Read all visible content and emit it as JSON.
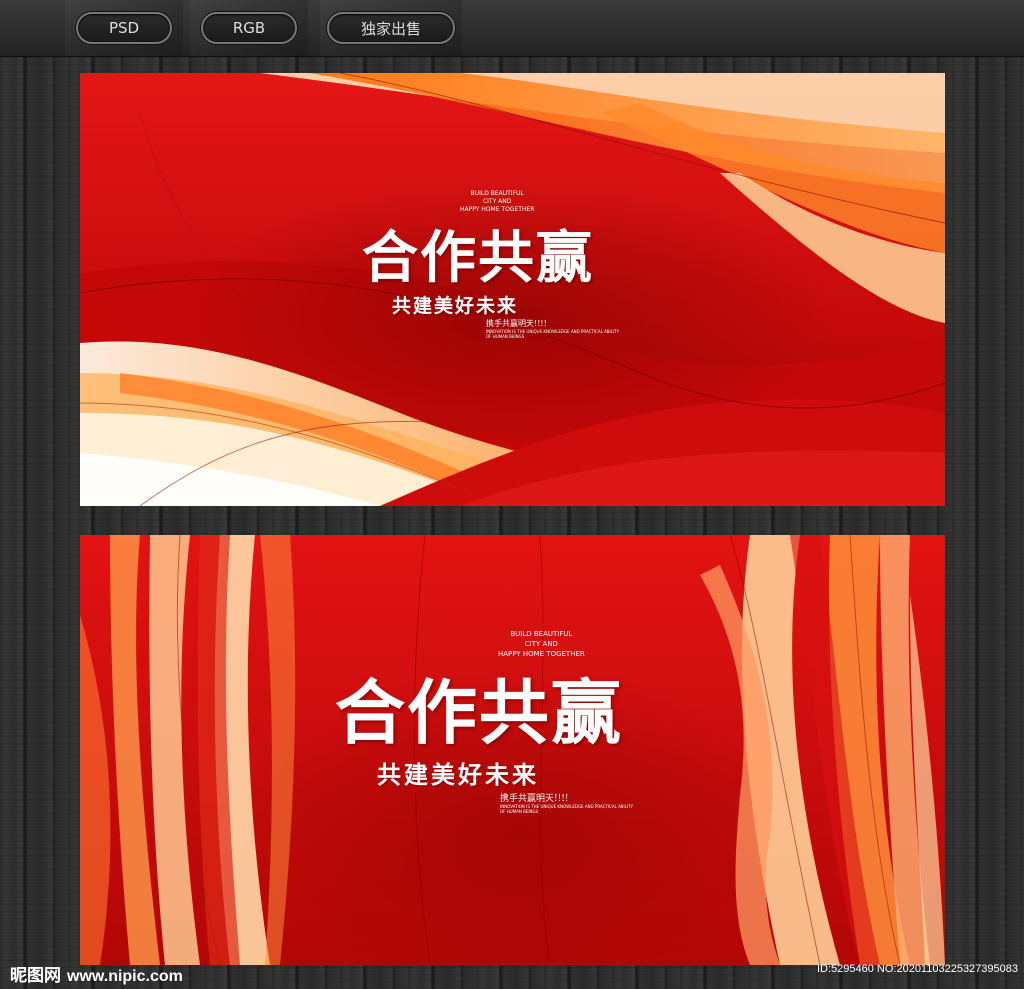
{
  "toolbar": {
    "tabs": [
      {
        "label": "PSD"
      },
      {
        "label": "RGB"
      },
      {
        "label": "独家出售"
      }
    ]
  },
  "banner": {
    "title": "合作共赢",
    "subtitle": "共建美好未来",
    "english_lines": [
      "BUILD BEAUTIFUL",
      "CITY AND",
      "HAPPY HOME TOGETHER"
    ],
    "tagline": "携手共赢明天!!!!",
    "tagline_english": [
      "INNOVATION IS THE UNIQUE KNOWLEDGE AND PRACTICAL ABILITY",
      "OF HUMAN BEINGS"
    ]
  },
  "colors": {
    "primary_red": "#d40d0d",
    "deep_red": "#9c0000",
    "orange": "#ff7a1a",
    "cream": "#ffd8a0"
  },
  "footer": {
    "site_name": "昵图网",
    "site_domain": "www.nipic.com",
    "id_text": "ID:5295460 NO:20201103225327395083"
  }
}
